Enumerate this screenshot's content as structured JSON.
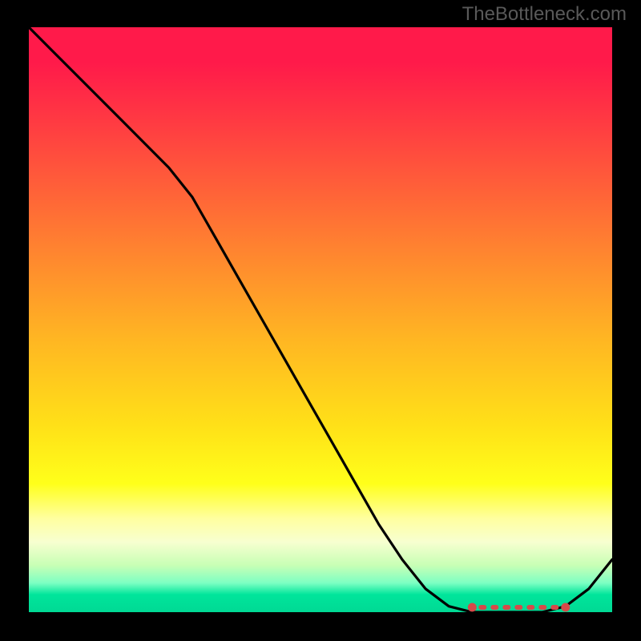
{
  "watermark": "TheBottleneck.com",
  "colors": {
    "curve": "#000000",
    "markers": "#d64a49",
    "frame_bg": "#000000"
  },
  "chart_data": {
    "type": "line",
    "title": "",
    "xlabel": "",
    "ylabel": "",
    "xlim": [
      0,
      100
    ],
    "ylim": [
      0,
      100
    ],
    "x": [
      0,
      4,
      8,
      12,
      16,
      20,
      24,
      28,
      32,
      36,
      40,
      44,
      48,
      52,
      56,
      60,
      64,
      68,
      72,
      76,
      80,
      84,
      88,
      92,
      96,
      100
    ],
    "values": [
      100,
      96,
      92,
      88,
      84,
      80,
      76,
      71,
      64,
      57,
      50,
      43,
      36,
      29,
      22,
      15,
      9,
      4,
      1,
      0,
      0,
      0,
      0,
      1,
      4,
      9
    ],
    "markers": {
      "x_start": 76,
      "x_end": 92,
      "y": 0
    },
    "gradient_stops": [
      {
        "pos": 0,
        "color": "#ff1a4a"
      },
      {
        "pos": 78,
        "color": "#ffff1a"
      },
      {
        "pos": 100,
        "color": "#00d994"
      }
    ]
  }
}
